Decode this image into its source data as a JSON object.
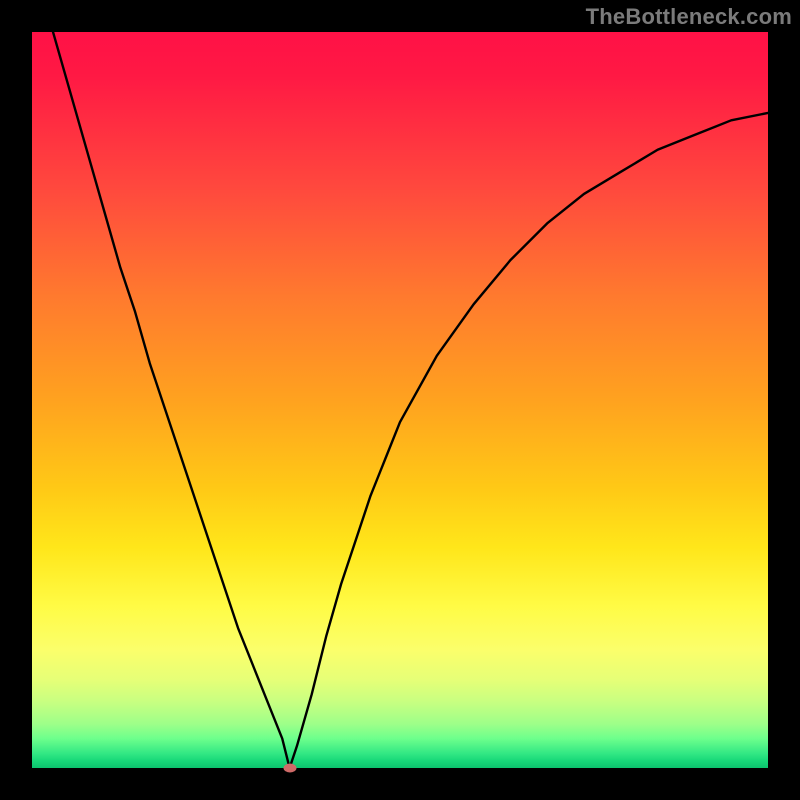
{
  "watermark": "TheBottleneck.com",
  "colors": {
    "frame": "#000000",
    "curve": "#000000",
    "marker": "#cf6a68"
  },
  "chart_data": {
    "type": "line",
    "title": "",
    "xlabel": "",
    "ylabel": "",
    "xlim": [
      0,
      100
    ],
    "ylim": [
      0,
      100
    ],
    "grid": false,
    "legend": false,
    "x": [
      0,
      2,
      4,
      6,
      8,
      10,
      12,
      14,
      16,
      18,
      20,
      22,
      24,
      26,
      28,
      30,
      32,
      34,
      35,
      36,
      38,
      40,
      42,
      44,
      46,
      48,
      50,
      55,
      60,
      65,
      70,
      75,
      80,
      85,
      90,
      95,
      100
    ],
    "values": [
      110,
      103,
      96,
      89,
      82,
      75,
      68,
      62,
      55,
      49,
      43,
      37,
      31,
      25,
      19,
      14,
      9,
      4,
      0,
      3,
      10,
      18,
      25,
      31,
      37,
      42,
      47,
      56,
      63,
      69,
      74,
      78,
      81,
      84,
      86,
      88,
      89
    ],
    "marker": {
      "x": 35,
      "y": 0
    },
    "notes": "Plot is a gradient-background V-curve with minimum near x≈35. No axis ticks or labels visible; values are estimated against the 0–100 normalized plot box. Left branch is roughly linear; right branch is concave, asymptoting below 100."
  }
}
